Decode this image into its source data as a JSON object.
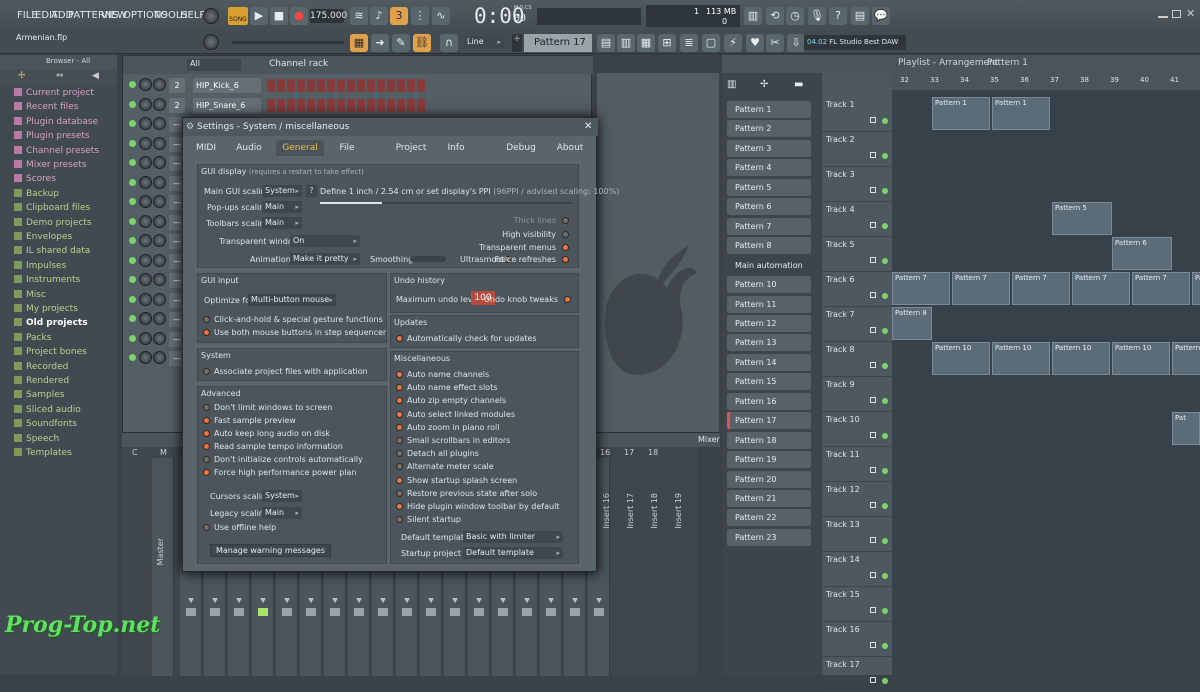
{
  "menu": [
    "FILE",
    "EDIT",
    "ADD",
    "PATTERNS",
    "VIEW",
    "OPTIONS",
    "TOOLS",
    "HELP"
  ],
  "transport": {
    "song_label": "SONG",
    "tempo": "175.000",
    "time": "0:00",
    "time_sub": "00",
    "time_unit": "M:S:CS",
    "cpu_top": "1",
    "mem": "113 MB",
    "cpu_bottom": "0"
  },
  "project": {
    "name": "Armenian.flp"
  },
  "toolbar2": {
    "snap": "Line",
    "pattern": "Pattern 17",
    "news_version": "04.02",
    "news_text": "FL Studio Best DAW"
  },
  "browser": {
    "title": "Browser - All",
    "items": [
      {
        "label": "Current project",
        "kind": "pink"
      },
      {
        "label": "Recent files",
        "kind": "pink"
      },
      {
        "label": "Plugin database",
        "kind": "pink"
      },
      {
        "label": "Plugin presets",
        "kind": "pink"
      },
      {
        "label": "Channel presets",
        "kind": "pink"
      },
      {
        "label": "Mixer presets",
        "kind": "pink"
      },
      {
        "label": "Scores",
        "kind": "pink"
      },
      {
        "label": "Backup",
        "kind": "green"
      },
      {
        "label": "Clipboard files",
        "kind": "green"
      },
      {
        "label": "Demo projects",
        "kind": "green"
      },
      {
        "label": "Envelopes",
        "kind": "green"
      },
      {
        "label": "IL shared data",
        "kind": "green"
      },
      {
        "label": "Impulses",
        "kind": "green"
      },
      {
        "label": "Instruments",
        "kind": "green"
      },
      {
        "label": "Misc",
        "kind": "green"
      },
      {
        "label": "My projects",
        "kind": "green"
      },
      {
        "label": "Old projects",
        "kind": "sel"
      },
      {
        "label": "Packs",
        "kind": "green"
      },
      {
        "label": "Project bones",
        "kind": "green"
      },
      {
        "label": "Recorded",
        "kind": "green"
      },
      {
        "label": "Rendered",
        "kind": "green"
      },
      {
        "label": "Samples",
        "kind": "green"
      },
      {
        "label": "Sliced audio",
        "kind": "green"
      },
      {
        "label": "Soundfonts",
        "kind": "green"
      },
      {
        "label": "Speech",
        "kind": "green"
      },
      {
        "label": "Templates",
        "kind": "green"
      }
    ]
  },
  "rack": {
    "filter": "All",
    "title": "Channel rack",
    "channels": [
      {
        "num": "2",
        "name": "HIP_Kick_6"
      },
      {
        "num": "2",
        "name": "HIP_Snare_6"
      }
    ]
  },
  "mixer": {
    "title": "Mixer",
    "master": "Master",
    "header_c": "C",
    "header_m": "M",
    "inserts": [
      "Insert 16",
      "Insert 17",
      "Insert 18",
      "Insert 19"
    ],
    "insert_nums": [
      "16",
      "17",
      "18"
    ]
  },
  "settings": {
    "title": "Settings - System / miscellaneous",
    "tabs": [
      "MIDI",
      "Audio",
      "General",
      "File",
      "Project",
      "Info",
      "Debug",
      "About"
    ],
    "gui_display": {
      "header": "GUI display",
      "note": "(requires a restart to take effect)",
      "main_scaling_label": "Main GUI scaling",
      "main_scaling": "System",
      "help": "?",
      "ppi_text": "Define 1 inch / 2.54 cm or set display's PPI",
      "ppi_value": "(96PPI / advised scaling: 100%)",
      "popups_label": "Pop-ups scaling",
      "popups": "Main",
      "toolbars_label": "Toolbars scaling",
      "toolbars": "Main",
      "thick_lines": "Thick lines",
      "high_vis": "High visibility",
      "transp_label": "Transparent windows",
      "transp": "On",
      "transp_menus": "Transparent menus",
      "anim_label": "Animations",
      "anim": "Make it pretty",
      "smoothing": "Smoothing",
      "ultrasmooth": "Ultrasmooth",
      "force_refresh": "Force refreshes"
    },
    "gui_input": {
      "header": "GUI input",
      "optimize_label": "Optimize for",
      "optimize": "Multi-button mouse",
      "opt1": "Click-and-hold & special gesture functions",
      "opt2": "Use both mouse buttons in step sequencer"
    },
    "undo": {
      "header": "Undo history",
      "max_label": "Maximum undo levels",
      "max": "100",
      "knob_tweaks": "Undo knob tweaks"
    },
    "updates": {
      "header": "Updates",
      "auto": "Automatically check for updates"
    },
    "system": {
      "header": "System",
      "assoc": "Associate project files with application"
    },
    "advanced": {
      "header": "Advanced",
      "items": [
        "Don't limit windows to screen",
        "Fast sample preview",
        "Auto keep long audio on disk",
        "Read sample tempo information",
        "Don't initialize controls automatically",
        "Force high performance power plan"
      ],
      "cursors_label": "Cursors scaling",
      "cursors": "System",
      "legacy_label": "Legacy scaling",
      "legacy": "Main",
      "offline": "Use offline help",
      "manage": "Manage warning messages"
    },
    "misc": {
      "header": "Miscellaneous",
      "items": [
        "Auto name channels",
        "Auto name effect slots",
        "Auto zip empty channels",
        "Auto select linked modules",
        "Auto zoom in piano roll",
        "Small scrollbars in editors",
        "Detach all plugins",
        "Alternate meter scale",
        "Show startup splash screen",
        "Restore previous state after solo",
        "Hide plugin window toolbar by default",
        "Silent startup"
      ],
      "states": [
        true,
        true,
        true,
        true,
        true,
        false,
        false,
        false,
        true,
        false,
        true,
        false
      ],
      "default_template_label": "Default template",
      "default_template": "Basic with limiter",
      "startup_label": "Startup project",
      "startup": "Default template"
    }
  },
  "playlist": {
    "title": "Playlist - Arrangement",
    "pattern": "Pattern 1",
    "ruler": [
      "32",
      "33",
      "34",
      "35",
      "36",
      "37",
      "38",
      "39",
      "40",
      "41"
    ],
    "patterns": [
      "Pattern 1",
      "Pattern 2",
      "Pattern 3",
      "Pattern 4",
      "Pattern 5",
      "Pattern 6",
      "Pattern 7",
      "Pattern 8",
      "Main automation",
      "Pattern 10",
      "Pattern 11",
      "Pattern 12",
      "Pattern 13",
      "Pattern 14",
      "Pattern 15",
      "Pattern 16",
      "Pattern 17",
      "Pattern 18",
      "Pattern 19",
      "Pattern 20",
      "Pattern 21",
      "Pattern 22",
      "Pattern 23"
    ],
    "tracks": [
      "Track 1",
      "Track 2",
      "Track 3",
      "Track 4",
      "Track 5",
      "Track 6",
      "Track 7",
      "Track 8",
      "Track 9",
      "Track 10",
      "Track 11",
      "Track 12",
      "Track 13",
      "Track 14",
      "Track 15",
      "Track 16",
      "Track 17"
    ],
    "clips": {
      "c1": "Pattern 1",
      "c5": "Pattern 5",
      "c6": "Pattern 6",
      "c7": "Pattern 7",
      "c8": "Pattern 8",
      "c10": "Pattern 10",
      "c_pat": "Pat"
    }
  },
  "watermark": "Prog-Top.net"
}
